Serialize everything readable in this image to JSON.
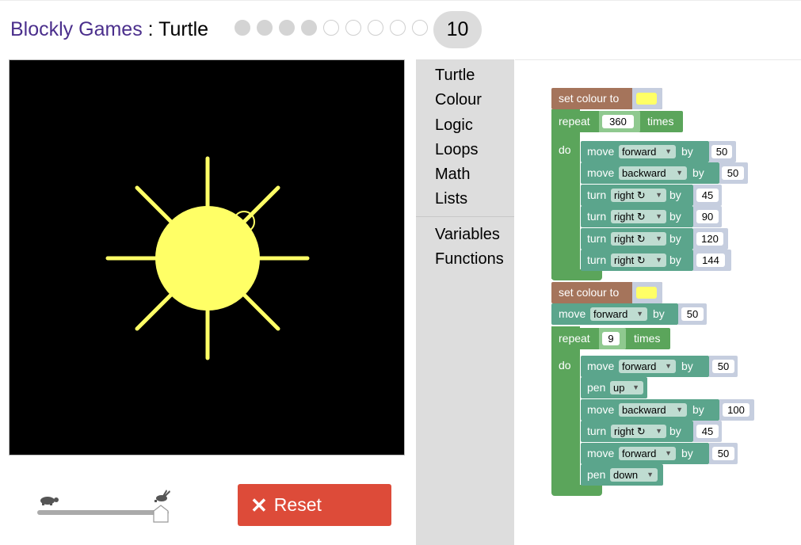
{
  "header": {
    "app_name": "Blockly Games",
    "separator": " : ",
    "game_name": "Turtle",
    "levels": [
      {
        "done": true
      },
      {
        "done": true
      },
      {
        "done": true
      },
      {
        "done": true
      },
      {
        "done": false
      },
      {
        "done": false
      },
      {
        "done": false
      },
      {
        "done": false
      },
      {
        "done": false
      }
    ],
    "current_level": "10"
  },
  "canvas": {
    "background": "#000000",
    "ink_color": "#ffff66"
  },
  "controls": {
    "speed_slow_icon": "turtle-icon",
    "speed_fast_icon": "rabbit-icon",
    "speed_value": 1.0,
    "reset_label": "Reset",
    "reset_icon": "close-icon",
    "reset_color": "#dd4b39"
  },
  "toolbox": {
    "categories": [
      "Turtle",
      "Colour",
      "Logic",
      "Loops",
      "Math",
      "Lists"
    ],
    "categories2": [
      "Variables",
      "Functions"
    ]
  },
  "program": {
    "set_colour_label": "set colour to",
    "repeat_label": "repeat",
    "times_label": "times",
    "do_label": "do",
    "move_label": "move",
    "by_label": "by",
    "turn_label": "turn",
    "pen_label": "pen",
    "colour_value": "#ffff66",
    "repeat1_count": "360",
    "repeat2_count": "9",
    "loop1": [
      {
        "dir": "forward",
        "value": "50"
      },
      {
        "dir": "backward",
        "value": "50"
      },
      {
        "dir": "right ↻",
        "value": "45"
      },
      {
        "dir": "right ↻",
        "value": "90"
      },
      {
        "dir": "right ↻",
        "value": "120"
      },
      {
        "dir": "right ↻",
        "value": "144"
      }
    ],
    "move_forward": {
      "dir": "forward",
      "value": "50"
    },
    "loop2": {
      "move1": {
        "dir": "forward",
        "value": "50"
      },
      "pen1": "up",
      "move2": {
        "dir": "backward",
        "value": "100"
      },
      "turn": {
        "dir": "right ↻",
        "value": "45"
      },
      "move3": {
        "dir": "forward",
        "value": "50"
      },
      "pen2": "down"
    }
  }
}
